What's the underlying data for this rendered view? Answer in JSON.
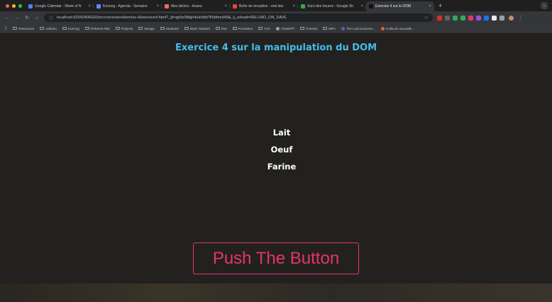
{
  "browser": {
    "tabs": [
      {
        "title": "Google Calendar - Week of N",
        "color": "#4285f4",
        "active": false
      },
      {
        "title": "Konnog - Agenda - Semaine",
        "color": "#5b8def",
        "active": false
      },
      {
        "title": "Mes tâches - Asana",
        "color": "#f06a6a",
        "active": false
      },
      {
        "title": "Boîte de réception - mel.sbu",
        "color": "#ea4335",
        "active": false
      },
      {
        "title": "Suivi des heures - Google Sh",
        "color": "#34a853",
        "active": false
      },
      {
        "title": "Exercice 4 sur le DOM",
        "color": "#111111",
        "active": true
      }
    ],
    "new_tab_label": "+",
    "url": "localhost:63342/BRG03/src/correction/dom/ex-4/exercice4.html?_ijt=qp5e0t8gh4ulch8d7f0dthmd45&_ij_reload=RELOAD_ON_SAVE",
    "bookmarks": [
      {
        "label": "Resources",
        "type": "folder"
      },
      {
        "label": "Artkiam",
        "type": "folder"
      },
      {
        "label": "Konnog",
        "type": "folder"
      },
      {
        "label": "Reforme-Site",
        "type": "folder"
      },
      {
        "label": "Projects",
        "type": "folder"
      },
      {
        "label": "Design",
        "type": "folder"
      },
      {
        "label": "Students",
        "type": "folder"
      },
      {
        "label": "Brain Teasers",
        "type": "folder"
      },
      {
        "label": "DW",
        "type": "folder"
      },
      {
        "label": "Formation",
        "type": "folder"
      },
      {
        "label": "TSA",
        "type": "folder"
      },
      {
        "label": "ChatGPT",
        "type": "dot",
        "color": "#9aa0a6"
      },
      {
        "label": "Freenet",
        "type": "folder"
      },
      {
        "label": "MPA",
        "type": "folder"
      },
      {
        "label": "The Lost Universe...",
        "type": "dot",
        "color": "#4a63c9"
      },
      {
        "label": "Collectio annuelle...",
        "type": "dot",
        "color": "#e0603a"
      }
    ],
    "extension_colors": [
      "#d93025",
      "#5f6368",
      "#34a853",
      "#34a853",
      "#e8336a",
      "#9b51e0",
      "#1a73e8",
      "#e8eaed",
      "#9aa0a6"
    ]
  },
  "page": {
    "title": "Exercice 4 sur la manipulation du DOM",
    "items": [
      "Lait",
      "Oeuf",
      "Farine"
    ],
    "button_label": "Push The Button",
    "colors": {
      "title": "#45bde6",
      "button": "#e8336a",
      "background": "#22211f"
    }
  }
}
